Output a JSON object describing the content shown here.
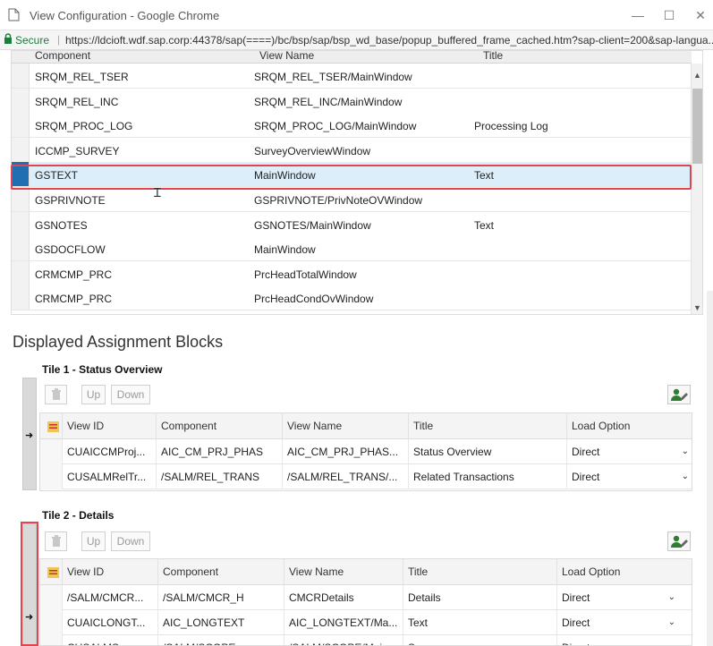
{
  "window": {
    "title": "View Configuration - Google Chrome",
    "controls": {
      "minimize": "—",
      "maximize": "☐",
      "close": "✕"
    }
  },
  "address": {
    "secure_label": "Secure",
    "url": "https://ldcioft.wdf.sap.corp:44378/sap(====)/bc/bsp/sap/bsp_wd_base/popup_buffered_frame_cached.htm?sap-client=200&sap-langua..."
  },
  "upper_table": {
    "columns": [
      "Component",
      "View Name",
      "Title"
    ],
    "rows": [
      {
        "component": "SRQM_REL_TSER",
        "view": "SRQM_REL_TSER/MainWindow",
        "title": ""
      },
      {
        "component": "SRQM_REL_INC",
        "view": "SRQM_REL_INC/MainWindow",
        "title": ""
      },
      {
        "component": "SRQM_PROC_LOG",
        "view": "SRQM_PROC_LOG/MainWindow",
        "title": "Processing Log"
      },
      {
        "component": "ICCMP_SURVEY",
        "view": "SurveyOverviewWindow",
        "title": ""
      },
      {
        "component": "GSTEXT",
        "view": "MainWindow",
        "title": "Text",
        "selected": true
      },
      {
        "component": "GSPRIVNOTE",
        "view": "GSPRIVNOTE/PrivNoteOVWindow",
        "title": ""
      },
      {
        "component": "GSNOTES",
        "view": "GSNOTES/MainWindow",
        "title": "Text"
      },
      {
        "component": "GSDOCFLOW",
        "view": "MainWindow",
        "title": ""
      },
      {
        "component": "CRMCMP_PRC",
        "view": "PrcHeadTotalWindow",
        "title": ""
      },
      {
        "component": "CRMCMP_PRC",
        "view": "PrcHeadCondOvWindow",
        "title": ""
      }
    ]
  },
  "section_heading": "Displayed Assignment Blocks",
  "toolbar": {
    "up": "Up",
    "down": "Down"
  },
  "tile1": {
    "title": "Tile 1 - Status Overview",
    "columns": [
      "View ID",
      "Component",
      "View Name",
      "Title",
      "Load Option"
    ],
    "rows": [
      {
        "view_id": "CUAICCMProj...",
        "component": "AIC_CM_PRJ_PHAS",
        "view_name": "AIC_CM_PRJ_PHAS...",
        "title": "Status Overview",
        "load": "Direct"
      },
      {
        "view_id": "CUSALMRelTr...",
        "component": "/SALM/REL_TRANS",
        "view_name": "/SALM/REL_TRANS/...",
        "title": "Related Transactions",
        "load": "Direct"
      }
    ]
  },
  "tile2": {
    "title": "Tile 2 - Details",
    "columns": [
      "View ID",
      "Component",
      "View Name",
      "Title",
      "Load Option"
    ],
    "rows": [
      {
        "view_id": "/SALM/CMCR...",
        "component": "/SALM/CMCR_H",
        "view_name": "CMCRDetails",
        "title": "Details",
        "load": "Direct"
      },
      {
        "view_id": "CUAICLONGT...",
        "component": "AIC_LONGTEXT",
        "view_name": "AIC_LONGTEXT/Ma...",
        "title": "Text",
        "load": "Direct"
      },
      {
        "view_id": "CUSALMScop...",
        "component": "/SALM/SCOPE",
        "view_name": "/SALM/SCOPE/Main...",
        "title": "Scope",
        "load": "Direct"
      }
    ]
  },
  "colors": {
    "highlight": "#e0454f",
    "selection": "#1f6fb2",
    "row_selected_bg": "#dceefa"
  },
  "icons": [
    "document-icon",
    "lock-icon",
    "trash-icon",
    "personalize-icon",
    "table-settings-icon",
    "row-arrow-icon",
    "text-cursor-icon"
  ]
}
